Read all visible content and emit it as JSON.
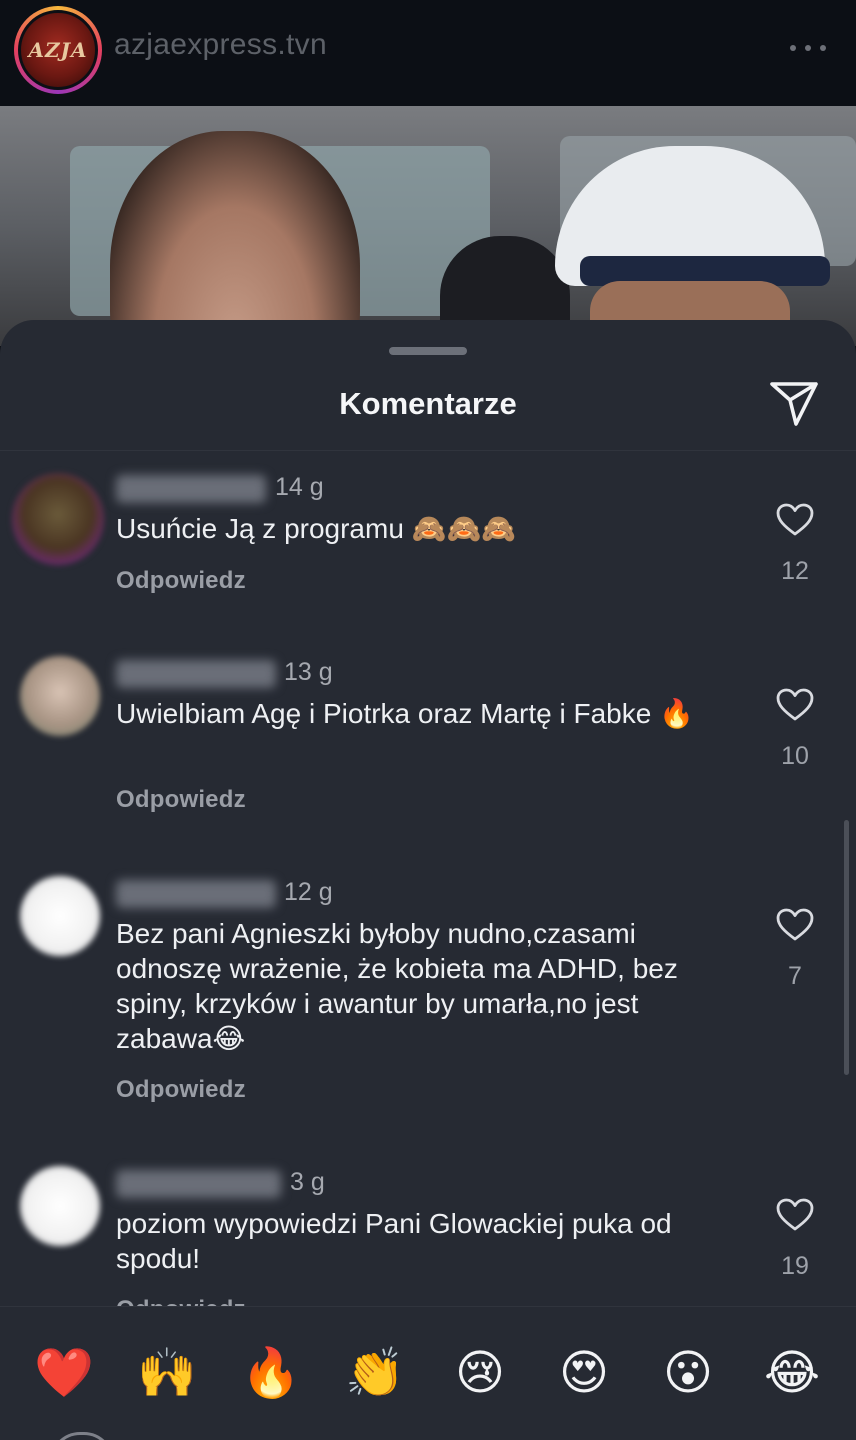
{
  "header": {
    "username": "azjaexpress.tvn",
    "avatar_text": "AZJA",
    "more_icon": "more-horizontal-icon"
  },
  "sheet": {
    "title": "Komentarze",
    "share_icon": "send-icon"
  },
  "comments": [
    {
      "username": "",
      "time": "14 g",
      "text": "Usuńcie Ją z programu 🙈🙈🙈",
      "reply_label": "Odpowiedz",
      "likes": "12"
    },
    {
      "username": "",
      "time": "13 g",
      "text": "Uwielbiam Agę i Piotrka oraz Martę i Fabke 🔥",
      "reply_label": "Odpowiedz",
      "likes": "10"
    },
    {
      "username": "",
      "time": "12 g",
      "text": "Bez pani Agnieszki byłoby nudno,czasami odnoszę wrażenie, że kobieta ma ADHD, bez spiny, krzyków i awantur by umarła,no jest zabawa😂",
      "reply_label": "Odpowiedz",
      "likes": "7"
    },
    {
      "username": "",
      "time": "3 g",
      "text": "poziom wypowiedzi Pani Glowackiej puka od spodu!",
      "reply_label": "Odpowiedz",
      "likes": "19"
    }
  ],
  "emoji_reactions": [
    "❤️",
    "🙌",
    "🔥",
    "👏",
    "😢",
    "😍",
    "😮",
    "😂"
  ],
  "colors": {
    "background": "#0c0f14",
    "sheet": "#262a33",
    "text": "#eef0f3",
    "muted": "#9a9ea6"
  }
}
